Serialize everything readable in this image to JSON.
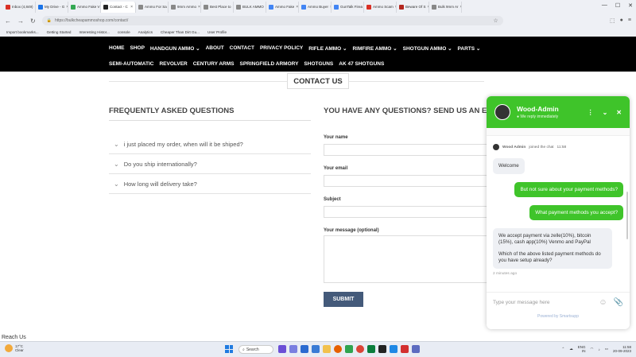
{
  "browser": {
    "tabs": [
      {
        "label": "Inbox (4,849)",
        "color": "#d93025"
      },
      {
        "label": "My Drive - G",
        "color": "#1a73e8"
      },
      {
        "label": "Ammo Fake V",
        "color": "#34a853"
      },
      {
        "label": "Contact - C",
        "color": "#222222",
        "active": true
      },
      {
        "label": "Ammo For Sa",
        "color": "#888888"
      },
      {
        "label": "9mm Ammo",
        "color": "#888888"
      },
      {
        "label": "Best Place to",
        "color": "#888888"
      },
      {
        "label": "BULK AMMO",
        "color": "#888888"
      },
      {
        "label": "Ammo Fake",
        "color": "#4285f4"
      },
      {
        "label": "Ammo Buyer",
        "color": "#4285f4"
      },
      {
        "label": "GunTalk Firea",
        "color": "#4285f4"
      },
      {
        "label": "Ammo Scam",
        "color": "#d93025"
      },
      {
        "label": "Beware Of S",
        "color": "#b3261e"
      },
      {
        "label": "Bulk 9mm Ar",
        "color": "#888888"
      }
    ],
    "url": "https://bulkcheapammoshop.com/contact/",
    "bookmarks": [
      "Import bookmarks...",
      "Getting Started",
      "Interesting Histor...",
      "console",
      "Analytics",
      "Cheaper Than Dirt Gu...",
      "User Profile"
    ]
  },
  "site_nav": {
    "row1": [
      {
        "label": "HOME"
      },
      {
        "label": "SHOP"
      },
      {
        "label": "HANDGUN AMMO",
        "dropdown": true
      },
      {
        "label": "ABOUT"
      },
      {
        "label": "CONTACT"
      },
      {
        "label": "PRIVACY POLICY"
      },
      {
        "label": "RIFLE AMMO",
        "dropdown": true
      },
      {
        "label": "RIMFIRE AMMO",
        "dropdown": true
      },
      {
        "label": "SHOTGUN AMMO",
        "dropdown": true
      },
      {
        "label": "PARTS",
        "dropdown": true
      }
    ],
    "row2": [
      "SEMI-AUTOMATIC",
      "REVOLVER",
      "CENTURY ARMS",
      "SPRINGFIELD ARMORY",
      "SHOTGUNS",
      "AK 47 SHOTGUNS"
    ]
  },
  "page": {
    "title": "CONTACT US",
    "faq_heading": "FREQUENTLY ASKED QUESTIONS",
    "faq": [
      "i just placed my order, when will it be shiped?",
      "Do you ship internationally?",
      "How long will delivery take?"
    ],
    "form_heading": "YOU HAVE ANY QUESTIONS? SEND US AN EMAIL",
    "labels": {
      "name": "Your name",
      "email": "Your email",
      "subject": "Subject",
      "message": "Your message (optional)"
    },
    "submit": "SUBMIT",
    "footer_text": "Reach Us"
  },
  "chat": {
    "agent": "Wood-Admin",
    "status": "We reply immediately",
    "joined_name": "Wood Admin",
    "joined_text": "joined the chat",
    "joined_time": "11:58",
    "welcome": "Welcome",
    "out1": "But not sure about your payment methods?",
    "out2": "What payment methods you accept?",
    "reply_p1": "We accept payment via zelle(10%), bitcoin (15%), cash app(10%) Venmo and PayPal",
    "reply_p2": "Which of the above listed payment methods do you have setup already?",
    "stamp": "2 minutes ago",
    "input_placeholder": "Type your message here",
    "powered": "Powered by Smartsupp",
    "accent": "#3fc42a"
  },
  "taskbar": {
    "temp": "17°C",
    "weather": "Clear",
    "search": "Search",
    "lang1": "ENG",
    "lang2": "IN",
    "time": "11:58",
    "date": "20-09-2023"
  }
}
